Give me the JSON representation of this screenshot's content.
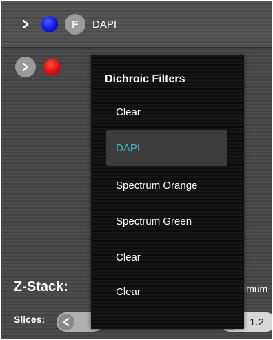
{
  "channels": [
    {
      "label": "DAPI",
      "filter_badge": "F",
      "color": "#0a16e6"
    },
    {
      "label": "",
      "color": "#e60a0a"
    }
  ],
  "dropdown": {
    "title": "Dichroic Filters",
    "items": [
      {
        "label": "Clear",
        "selected": false
      },
      {
        "label": "DAPI",
        "selected": true
      },
      {
        "label": "Spectrum Orange",
        "selected": false
      },
      {
        "label": "Spectrum Green",
        "selected": false
      },
      {
        "label": "Clear",
        "selected": false
      },
      {
        "label": "Clear",
        "selected": false
      }
    ],
    "selected_color": "#33c0d0"
  },
  "zstack": {
    "label": "Z-Stack:",
    "max_label_partial": "imum",
    "slices_label": "Slices:",
    "value": "1.2"
  }
}
